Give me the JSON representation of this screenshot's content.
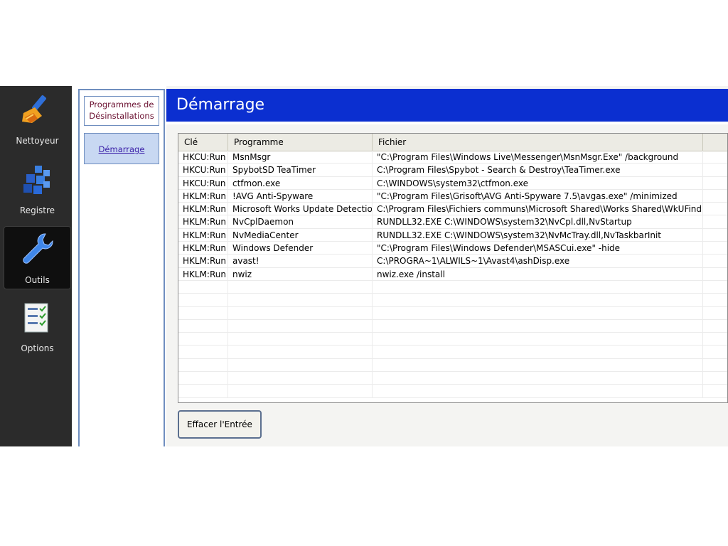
{
  "sidebar": {
    "items": [
      {
        "label": "Nettoyeur",
        "icon": "broom-icon"
      },
      {
        "label": "Registre",
        "icon": "registry-cubes-icon"
      },
      {
        "label": "Outils",
        "icon": "wrench-icon",
        "active": true
      },
      {
        "label": "Options",
        "icon": "checklist-icon"
      }
    ]
  },
  "subnav": {
    "items": [
      {
        "label": "Programmes de Désinstallations"
      },
      {
        "label": "Démarrage",
        "active": true
      }
    ]
  },
  "main": {
    "title": "Démarrage",
    "table": {
      "headers": [
        "Clé",
        "Programme",
        "Fichier"
      ],
      "rows": [
        [
          "HKCU:Run",
          "MsnMsgr",
          "\"C:\\Program Files\\Windows Live\\Messenger\\MsnMsgr.Exe\" /background"
        ],
        [
          "HKCU:Run",
          "SpybotSD TeaTimer",
          "C:\\Program Files\\Spybot - Search & Destroy\\TeaTimer.exe"
        ],
        [
          "HKCU:Run",
          "ctfmon.exe",
          "C:\\WINDOWS\\system32\\ctfmon.exe"
        ],
        [
          "HKLM:Run",
          "!AVG Anti-Spyware",
          "\"C:\\Program Files\\Grisoft\\AVG Anti-Spyware 7.5\\avgas.exe\" /minimized"
        ],
        [
          "HKLM:Run",
          "Microsoft Works Update Detection",
          "C:\\Program Files\\Fichiers communs\\Microsoft Shared\\Works Shared\\WkUFind.exe"
        ],
        [
          "HKLM:Run",
          "NvCplDaemon",
          "RUNDLL32.EXE C:\\WINDOWS\\system32\\NvCpl.dll,NvStartup"
        ],
        [
          "HKLM:Run",
          "NvMediaCenter",
          "RUNDLL32.EXE C:\\WINDOWS\\system32\\NvMcTray.dll,NvTaskbarInit"
        ],
        [
          "HKLM:Run",
          "Windows Defender",
          "\"C:\\Program Files\\Windows Defender\\MSASCui.exe\" -hide"
        ],
        [
          "HKLM:Run",
          "avast!",
          "C:\\PROGRA~1\\ALWILS~1\\Avast4\\ashDisp.exe"
        ],
        [
          "HKLM:Run",
          "nwiz",
          "nwiz.exe /install"
        ]
      ]
    },
    "delete_button": "Effacer l'Entrée"
  },
  "colors": {
    "title_bar": "#0b2fd0",
    "sidebar_bg": "#2b2b2b",
    "subnav_active": "#c8d8f2"
  }
}
